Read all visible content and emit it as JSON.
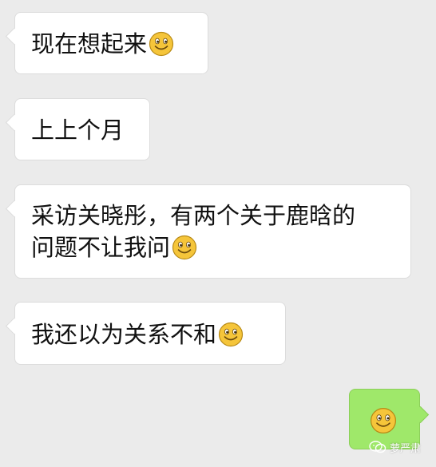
{
  "messages": [
    {
      "side": "left",
      "lines": [
        "现在想起来"
      ],
      "emoji": "smile-emoji-icon"
    },
    {
      "side": "left",
      "lines": [
        "上上个月"
      ]
    },
    {
      "side": "left",
      "lines": [
        "采访关晓彤，有两个关于鹿晗的",
        "问题不让我问"
      ],
      "emoji": "smile-emoji-icon"
    },
    {
      "side": "left",
      "lines": [
        "我还以为关系不和"
      ],
      "emoji": "smile-emoji-icon"
    },
    {
      "side": "right",
      "lines": [],
      "emoji": "smile-emoji-icon"
    }
  ],
  "watermark": {
    "text": "萝严肃",
    "icon": "wechat-icon"
  },
  "colors": {
    "background": "#ebebeb",
    "left_bubble": "#ffffff",
    "right_bubble": "#9fe86a",
    "emoji_face": "#f5c53a"
  }
}
